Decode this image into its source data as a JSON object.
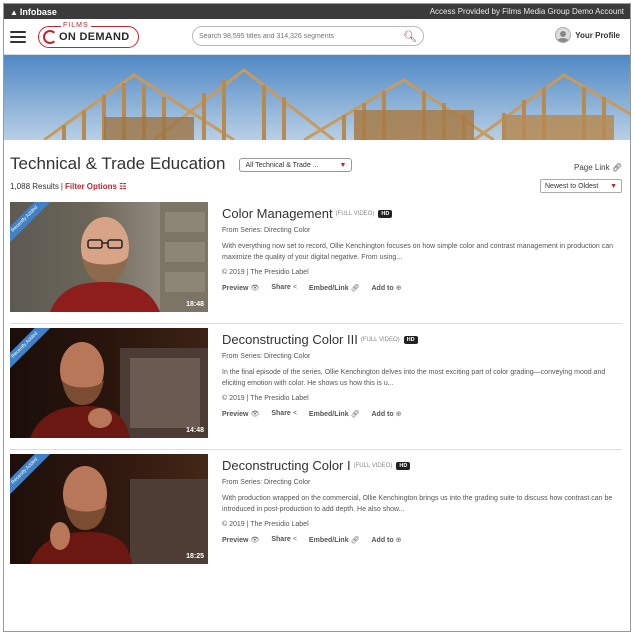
{
  "topbar": {
    "brand": "Infobase",
    "access": "Access Provided by Films Media Group Demo Account"
  },
  "header": {
    "logo_small": "FILMS",
    "logo_big": "ON DEMAND",
    "search_placeholder": "Search 98,595 titles and 314,326 segments",
    "profile_label": "Your Profile"
  },
  "page": {
    "title": "Technical & Trade Education",
    "category_select": "All Technical & Trade ...",
    "page_link": "Page Link",
    "results": "1,088 Results",
    "results_sep": "|",
    "filter_options": "Filter Options",
    "sort": "Newest to Oldest"
  },
  "items": [
    {
      "title": "Color Management",
      "full": "(Full Video)",
      "hd": "HD",
      "series": "From Series: Directing Color",
      "desc": "With everything now set to record, Ollie Kenchington focuses on how simple color and contrast management in production can maximize the quality of your digital negative. From using...",
      "meta": "© 2019 | The Presidio Label",
      "duration": "18:48",
      "ribbon": "Recently Added"
    },
    {
      "title": "Deconstructing Color III",
      "full": "(Full Video)",
      "hd": "HD",
      "series": "From Series: Directing Color",
      "desc": "In the final episode of the series, Ollie Kenchington delves into the most exciting part of color grading—conveying mood and eliciting emotion with color. He shows us how this is u...",
      "meta": "© 2019 | The Presidio Label",
      "duration": "14:48",
      "ribbon": "Recently Added"
    },
    {
      "title": "Deconstructing Color I",
      "full": "(Full Video)",
      "hd": "HD",
      "series": "From Series: Directing Color",
      "desc": "With production wrapped on the commercial, Ollie Kenchington brings us into the grading suite to discuss how contrast can be introduced in post-production to add depth. He also show...",
      "meta": "© 2019 | The Presidio Label",
      "duration": "18:25",
      "ribbon": "Recently Added"
    }
  ],
  "actions": {
    "preview": "Preview",
    "share": "Share",
    "embed": "Embed/Link",
    "add": "Add to"
  },
  "colors": {
    "accent": "#c8232c",
    "ribbon": "#3f82c9",
    "topbar": "#3b3b3b"
  }
}
